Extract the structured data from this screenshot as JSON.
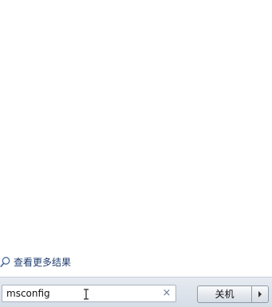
{
  "start_menu": {
    "see_more_label": "查看更多结果",
    "search": {
      "value": "msconfig",
      "clear_glyph": "×"
    },
    "shutdown": {
      "label": "关机"
    }
  },
  "icons": {
    "search": "search-icon",
    "clear": "close-icon",
    "cursor": "text-cursor-icon",
    "arrow": "chevron-right-icon"
  }
}
